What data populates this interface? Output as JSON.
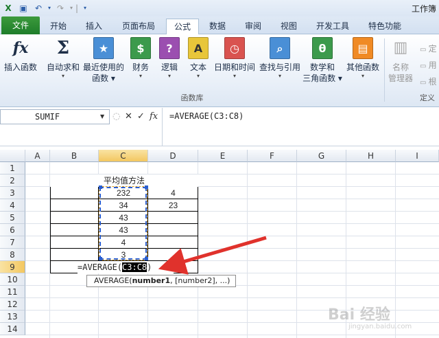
{
  "window": {
    "title": "工作簿"
  },
  "qat": {
    "dropdown": "▾",
    "separator": "|"
  },
  "tabs": [
    {
      "label": "文件"
    },
    {
      "label": "开始"
    },
    {
      "label": "插入"
    },
    {
      "label": "页面布局"
    },
    {
      "label": "公式"
    },
    {
      "label": "数据"
    },
    {
      "label": "审阅"
    },
    {
      "label": "视图"
    },
    {
      "label": "开发工具"
    },
    {
      "label": "特色功能"
    }
  ],
  "ribbon": {
    "buttons": [
      {
        "label": "插入函数",
        "sub": ""
      },
      {
        "label": "自动求和",
        "sub": "▾"
      },
      {
        "label": "最近使用的",
        "sub": "函数 ▾"
      },
      {
        "label": "财务",
        "sub": "▾"
      },
      {
        "label": "逻辑",
        "sub": "▾"
      },
      {
        "label": "文本",
        "sub": "▾"
      },
      {
        "label": "日期和时间",
        "sub": "▾"
      },
      {
        "label": "查找与引用",
        "sub": "▾"
      },
      {
        "label": "数学和",
        "sub": "三角函数 ▾"
      },
      {
        "label": "其他函数",
        "sub": "▾"
      },
      {
        "label": "名称",
        "sub": "管理器"
      }
    ],
    "side_items": [
      "定",
      "用",
      "根"
    ],
    "group_label": "函数库",
    "group_label_2": "定义"
  },
  "formula_bar": {
    "namebox": "SUMIF",
    "formula": "=AVERAGE(C3:C8)",
    "fx": "fx"
  },
  "grid": {
    "columns": [
      "A",
      "B",
      "C",
      "D",
      "E",
      "F",
      "G",
      "H",
      "I"
    ],
    "rows": [
      "1",
      "2",
      "3",
      "4",
      "5",
      "6",
      "7",
      "8",
      "9",
      "10",
      "11",
      "12",
      "13",
      "14"
    ],
    "title": "平均值方法",
    "c_values": [
      "232",
      "34",
      "43",
      "43",
      "4",
      "3"
    ],
    "d_values": [
      "4",
      "23"
    ],
    "edit_prefix": "=AVERAGE(",
    "edit_ref": "C3:C8",
    "edit_suffix": ")"
  },
  "tooltip": {
    "func": "AVERAGE(",
    "arg1": "number1",
    "rest": ", [number2], ...)"
  },
  "watermark": {
    "main": "Bai 经验",
    "sub": "jingyan.baidu.com"
  }
}
